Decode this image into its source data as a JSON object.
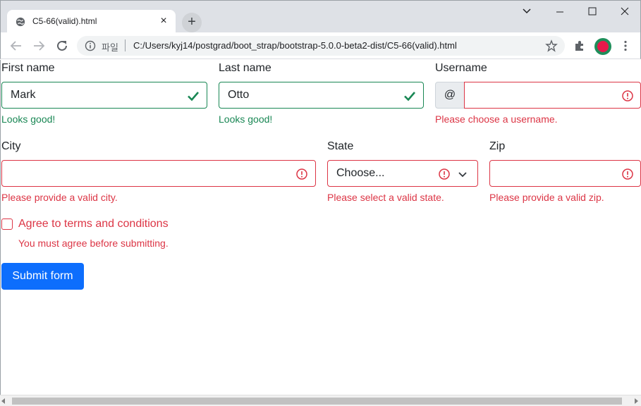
{
  "browser": {
    "tab_title": "C5-66(valid).html",
    "tab_close": "×",
    "new_tab": "+",
    "url_scheme": "파일",
    "url": "C:/Users/kyj14/postgrad/boot_strap/bootstrap-5.0.0-beta2-dist/C5-66(valid).html"
  },
  "form": {
    "first_name": {
      "label": "First name",
      "value": "Mark",
      "feedback": "Looks good!"
    },
    "last_name": {
      "label": "Last name",
      "value": "Otto",
      "feedback": "Looks good!"
    },
    "username": {
      "label": "Username",
      "prefix": "@",
      "value": "",
      "feedback": "Please choose a username."
    },
    "city": {
      "label": "City",
      "value": "",
      "feedback": "Please provide a valid city."
    },
    "state": {
      "label": "State",
      "selected": "Choose...",
      "feedback": "Please select a valid state."
    },
    "zip": {
      "label": "Zip",
      "value": "",
      "feedback": "Please provide a valid zip."
    },
    "terms": {
      "label": "Agree to terms and conditions",
      "feedback": "You must agree before submitting."
    },
    "submit_label": "Submit form"
  },
  "colors": {
    "valid": "#198754",
    "invalid": "#dc3545",
    "primary": "#0d6efd"
  }
}
